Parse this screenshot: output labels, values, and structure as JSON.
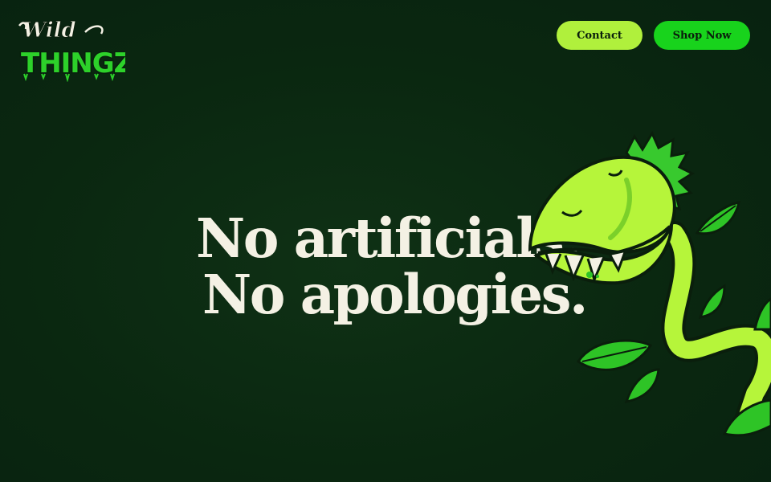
{
  "brand": {
    "logo_top": "Wild",
    "logo_bottom": "THINGZ",
    "accent": "#b0f03c",
    "brand_green": "#18d31c",
    "background": "#0a2710"
  },
  "nav": {
    "contact_label": "Contact",
    "shop_label": "Shop Now"
  },
  "hero": {
    "line1": "No artificials.",
    "line2": "No apologies.",
    "illustration": "venus-flytrap-icon"
  }
}
